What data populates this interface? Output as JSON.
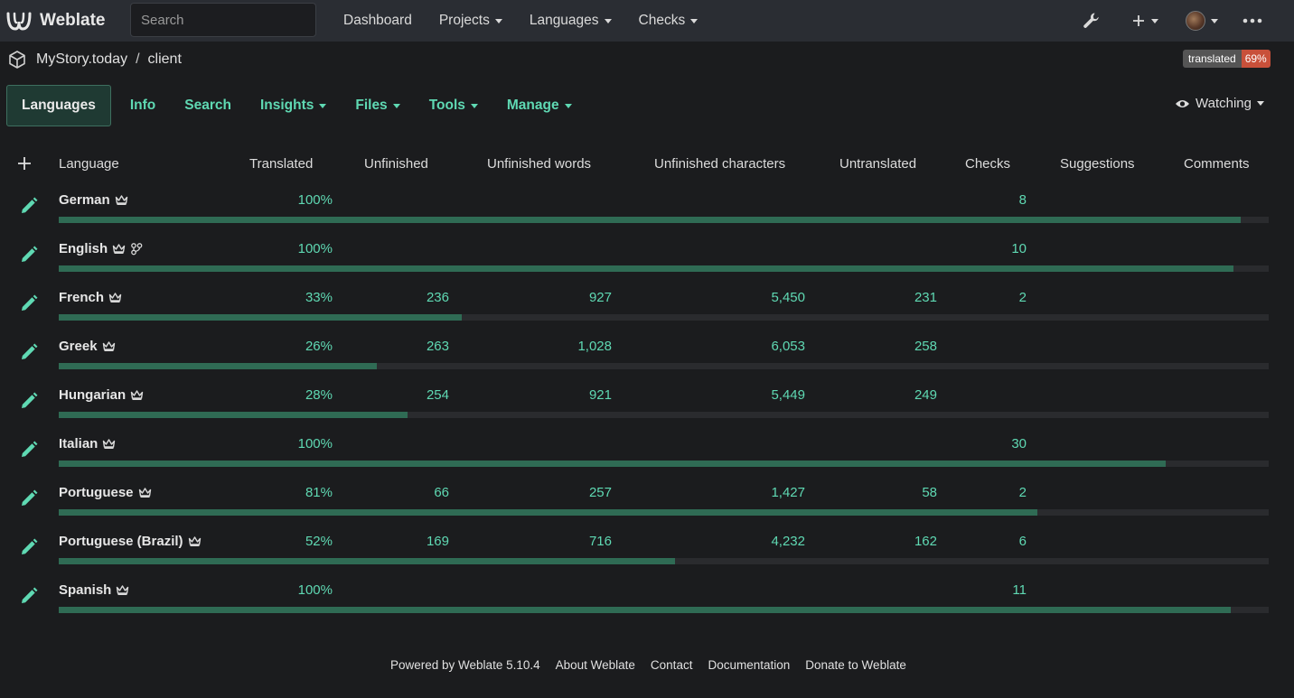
{
  "navbar": {
    "brand": "Weblate",
    "search_placeholder": "Search",
    "items": [
      {
        "label": "Dashboard",
        "dropdown": false
      },
      {
        "label": "Projects",
        "dropdown": true
      },
      {
        "label": "Languages",
        "dropdown": true
      },
      {
        "label": "Checks",
        "dropdown": true
      }
    ]
  },
  "breadcrumb": {
    "project": "MyStory.today",
    "separator": "/",
    "component": "client"
  },
  "badge": {
    "label": "translated",
    "value": "69%"
  },
  "tabs": [
    {
      "label": "Languages",
      "dropdown": false,
      "active": true
    },
    {
      "label": "Info",
      "dropdown": false
    },
    {
      "label": "Search",
      "dropdown": false
    },
    {
      "label": "Insights",
      "dropdown": true
    },
    {
      "label": "Files",
      "dropdown": true
    },
    {
      "label": "Tools",
      "dropdown": true
    },
    {
      "label": "Manage",
      "dropdown": true
    }
  ],
  "watching": "Watching",
  "table": {
    "headers": {
      "language": "Language",
      "translated": "Translated",
      "unfinished": "Unfinished",
      "unfinished_words": "Unfinished words",
      "unfinished_characters": "Unfinished characters",
      "untranslated": "Untranslated",
      "checks": "Checks",
      "suggestions": "Suggestions",
      "comments": "Comments"
    },
    "rows": [
      {
        "language": "German",
        "source": false,
        "translated": "100%",
        "unfinished": "",
        "unfinished_words": "",
        "unfinished_characters": "",
        "untranslated": "",
        "checks": "8",
        "progress": 0.977
      },
      {
        "language": "English",
        "source": true,
        "translated": "100%",
        "unfinished": "",
        "unfinished_words": "",
        "unfinished_characters": "",
        "untranslated": "",
        "checks": "10",
        "progress": 0.971
      },
      {
        "language": "French",
        "source": false,
        "translated": "33%",
        "unfinished": "236",
        "unfinished_words": "927",
        "unfinished_characters": "5,450",
        "untranslated": "231",
        "checks": "2",
        "progress": 0.333
      },
      {
        "language": "Greek",
        "source": false,
        "translated": "26%",
        "unfinished": "263",
        "unfinished_words": "1,028",
        "unfinished_characters": "6,053",
        "untranslated": "258",
        "checks": "",
        "progress": 0.263
      },
      {
        "language": "Hungarian",
        "source": false,
        "translated": "28%",
        "unfinished": "254",
        "unfinished_words": "921",
        "unfinished_characters": "5,449",
        "untranslated": "249",
        "checks": "",
        "progress": 0.288
      },
      {
        "language": "Italian",
        "source": false,
        "translated": "100%",
        "unfinished": "",
        "unfinished_words": "",
        "unfinished_characters": "",
        "untranslated": "",
        "checks": "30",
        "progress": 0.915
      },
      {
        "language": "Portuguese",
        "source": false,
        "translated": "81%",
        "unfinished": "66",
        "unfinished_words": "257",
        "unfinished_characters": "1,427",
        "untranslated": "58",
        "checks": "2",
        "progress": 0.809
      },
      {
        "language": "Portuguese (Brazil)",
        "source": false,
        "translated": "52%",
        "unfinished": "169",
        "unfinished_words": "716",
        "unfinished_characters": "4,232",
        "untranslated": "162",
        "checks": "6",
        "progress": 0.509
      },
      {
        "language": "Spanish",
        "source": false,
        "translated": "100%",
        "unfinished": "",
        "unfinished_words": "",
        "unfinished_characters": "",
        "untranslated": "",
        "checks": "11",
        "progress": 0.969
      }
    ]
  },
  "footer": [
    "Powered by Weblate 5.10.4",
    "About Weblate",
    "Contact",
    "Documentation",
    "Donate to Weblate"
  ],
  "colors": {
    "accent": "#5fd9b3",
    "bar_fill": "#2f6b54",
    "bar_track": "#2a2b2e",
    "badge_value": "#c8503a"
  }
}
